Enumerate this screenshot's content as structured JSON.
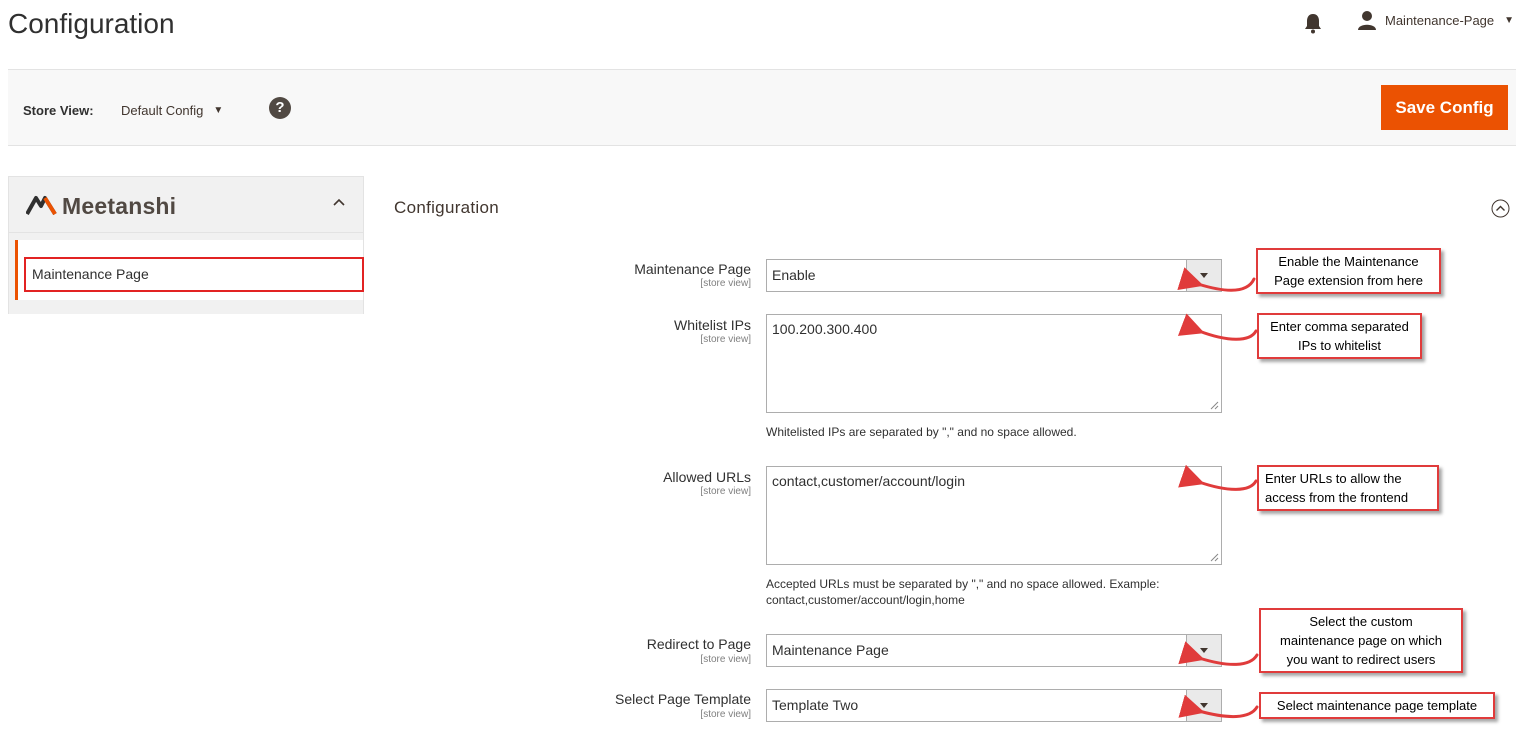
{
  "header": {
    "title": "Configuration",
    "user": "Maintenance-Page"
  },
  "store_bar": {
    "label": "Store View:",
    "value": "Default Config",
    "help": "?",
    "save_label": "Save Config"
  },
  "sidebar": {
    "brand": "Meetanshi",
    "items": [
      {
        "label": "Maintenance Page"
      }
    ]
  },
  "section": {
    "title": "Configuration"
  },
  "fields": {
    "maintenance_page": {
      "label": "Maintenance Page",
      "scope": "[store view]",
      "value": "Enable"
    },
    "whitelist_ips": {
      "label": "Whitelist IPs",
      "scope": "[store view]",
      "value": "100.200.300.400",
      "note": "Whitelisted IPs are separated by \",\" and no space allowed."
    },
    "allowed_urls": {
      "label": "Allowed URLs",
      "scope": "[store view]",
      "value": "contact,customer/account/login",
      "note_line1": "Accepted URLs must be separated by \",\" and no space allowed. Example:",
      "note_line2": "contact,customer/account/login,home"
    },
    "redirect_to_page": {
      "label": "Redirect to Page",
      "scope": "[store view]",
      "value": "Maintenance Page"
    },
    "page_template": {
      "label": "Select Page Template",
      "scope": "[store view]",
      "value": "Template Two"
    }
  },
  "callouts": {
    "enable_line1": "Enable the Maintenance",
    "enable_line2": "Page extension from here",
    "ips_line1": "Enter comma separated",
    "ips_line2": "IPs to whitelist",
    "urls_line1": "Enter URLs to allow the",
    "urls_line2": "access from the frontend",
    "redirect_line1": "Select the custom",
    "redirect_line2": "maintenance page on which",
    "redirect_line3": "you want to redirect users",
    "template": "Select maintenance page template"
  },
  "colors": {
    "accent": "#eb5202",
    "annotation": "#e03b3b"
  }
}
